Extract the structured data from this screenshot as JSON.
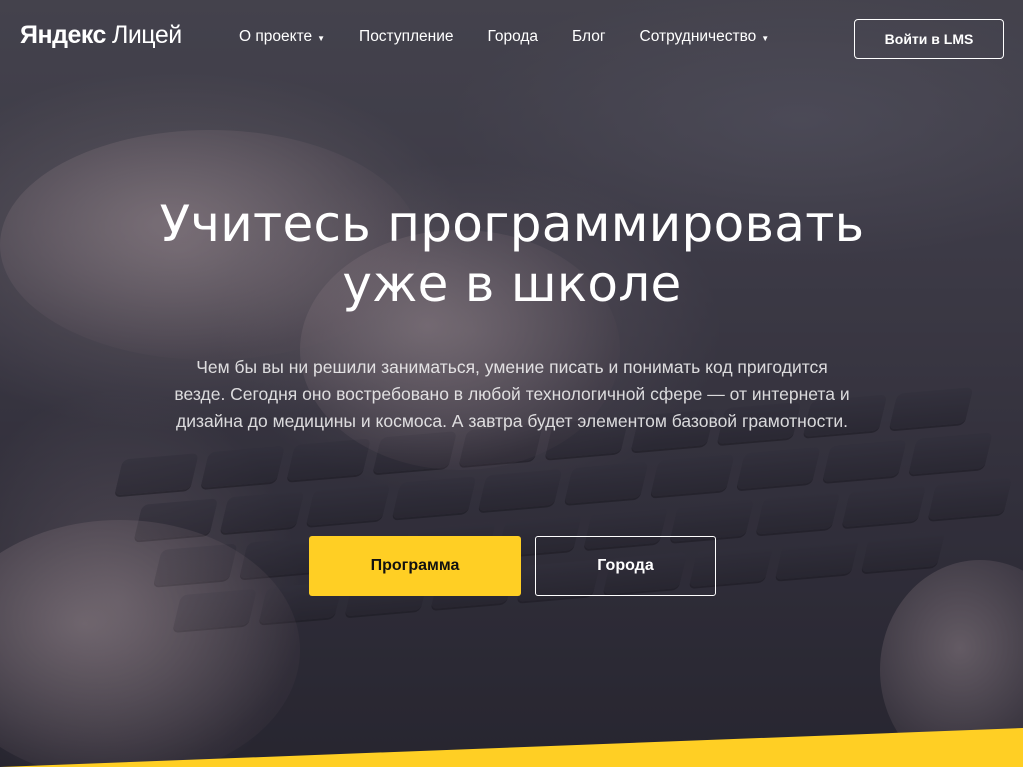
{
  "header": {
    "logo_brand": "Яндекс",
    "logo_product": "Лицей",
    "nav": [
      {
        "label": "О проекте",
        "has_dropdown": true
      },
      {
        "label": "Поступление",
        "has_dropdown": false
      },
      {
        "label": "Города",
        "has_dropdown": false
      },
      {
        "label": "Блог",
        "has_dropdown": false
      },
      {
        "label": "Сотрудничество",
        "has_dropdown": true
      }
    ],
    "lms_button": "Войти в LMS",
    "dropdown_icon": "caret-down-icon"
  },
  "hero": {
    "title_line1": "Учитесь программировать",
    "title_line2": "уже в школе",
    "lead": "Чем бы вы ни решили заниматься, умение писать и понимать код пригодится везде. Сегодня оно востребовано в любой технологичной сфере — от интернета и дизайна до медицины и космоса. А завтра будет элементом базовой грамотности.",
    "primary_button": "Программа",
    "secondary_button": "Города"
  },
  "colors": {
    "accent": "#ffcf24",
    "text": "#ffffff"
  }
}
